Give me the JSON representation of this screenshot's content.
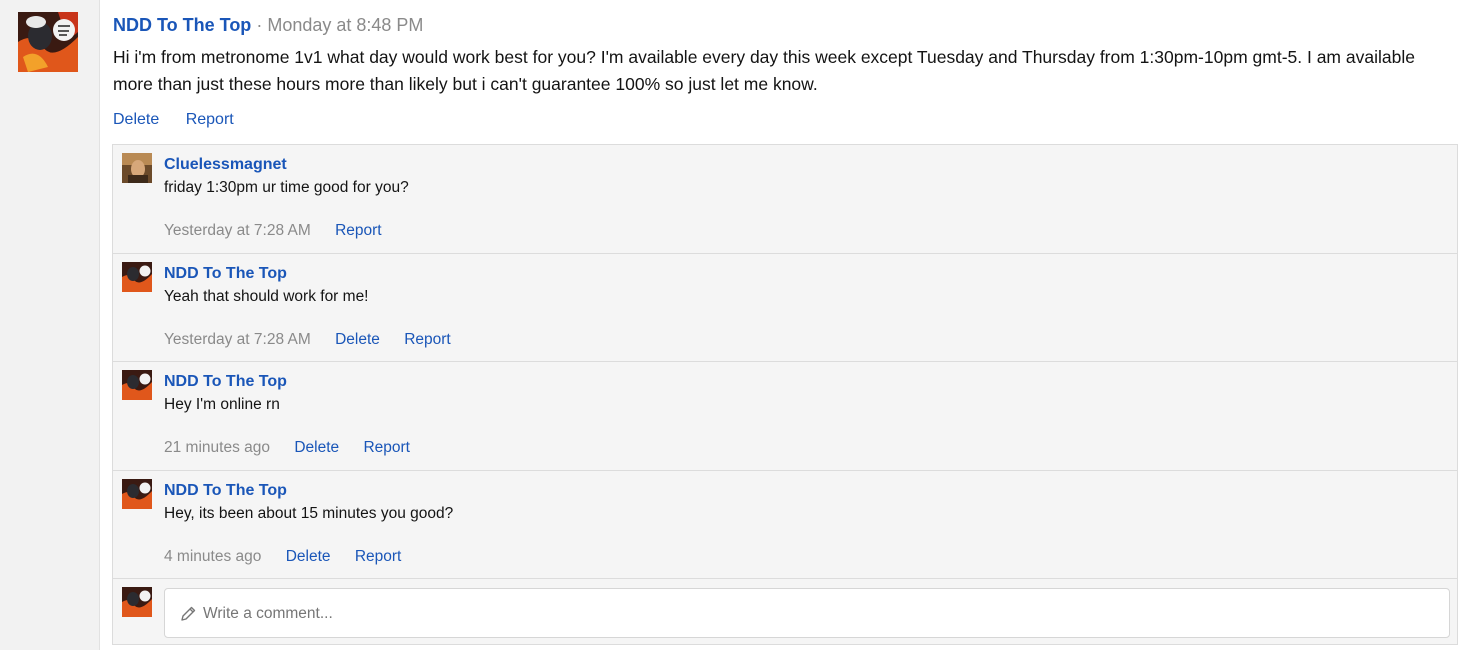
{
  "post": {
    "author": "NDD To The Top",
    "separator": "·",
    "timestamp": "Monday at 8:48 PM",
    "body": "Hi i'm from metronome 1v1 what day would work best for you? I'm available every day this week except Tuesday and Thursday from 1:30pm-10pm gmt-5. I am available more than just these hours more than likely but i can't guarantee 100% so just let me know.",
    "actions": {
      "delete": "Delete",
      "report": "Report"
    }
  },
  "comments": [
    {
      "author": "Cluelessmagnet",
      "text": "friday 1:30pm ur time good for you?",
      "time": "Yesterday at 7:28 AM",
      "delete": "",
      "report": "Report"
    },
    {
      "author": "NDD To The Top",
      "text": "Yeah that should work for me!",
      "time": "Yesterday at 7:28 AM",
      "delete": "Delete",
      "report": "Report"
    },
    {
      "author": "NDD To The Top",
      "text": "Hey I'm online rn",
      "time": "21 minutes ago",
      "delete": "Delete",
      "report": "Report"
    },
    {
      "author": "NDD To The Top",
      "text": "Hey, its been about 15 minutes you good?",
      "time": "4 minutes ago",
      "delete": "Delete",
      "report": "Report"
    }
  ],
  "comment_box": {
    "placeholder": "Write a comment..."
  },
  "icons": {
    "compose": "pencil-icon"
  },
  "colors": {
    "link": "#1a56b8",
    "muted": "#8a8a8a",
    "panel": "#f5f5f5"
  }
}
